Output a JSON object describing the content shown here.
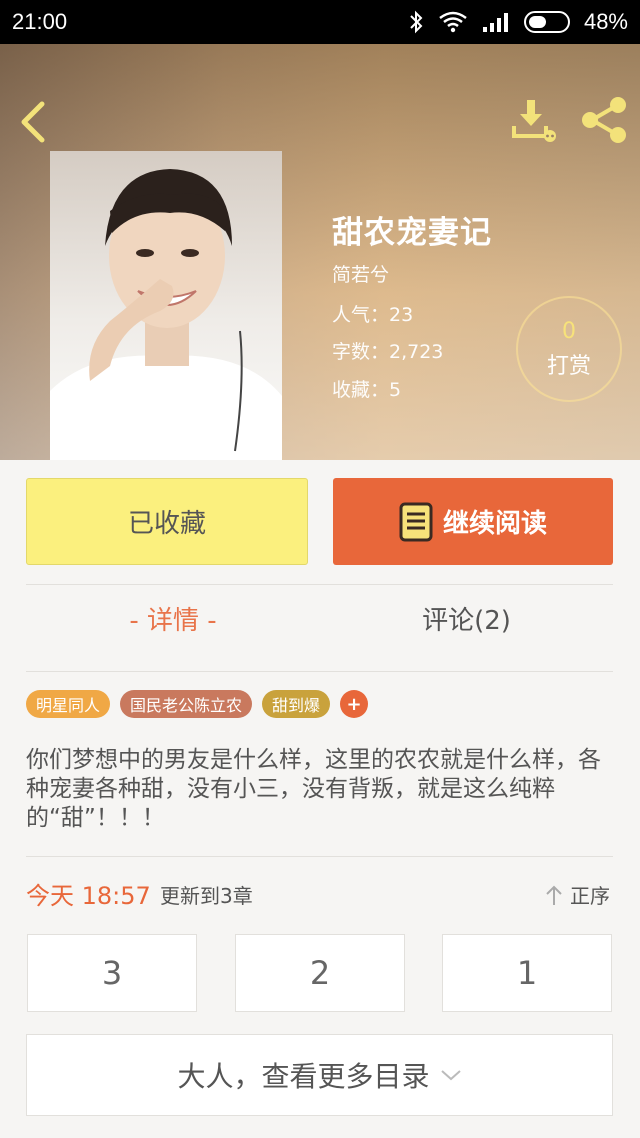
{
  "status_bar": {
    "time": "21:00",
    "battery": "48%",
    "battery_level": 0.48
  },
  "book": {
    "title": "甜农宠妻记",
    "author": "简若兮",
    "popularity": "人气：23",
    "word_count": "字数：2,723",
    "favorites": "收藏：5",
    "reward_count": "0",
    "reward_label": "打赏"
  },
  "actions": {
    "collected_label": "已收藏",
    "continue_label": "继续阅读"
  },
  "tabs": {
    "detail_label": "- 详情 -",
    "comments_label": "评论(2)"
  },
  "tags": [
    {
      "label": "明星同人",
      "color": "#f0a845"
    },
    {
      "label": "国民老公陈立农",
      "color": "#c9795e"
    },
    {
      "label": "甜到爆",
      "color": "#c9a23c"
    }
  ],
  "tag_add_label": "+",
  "description": "你们梦想中的男友是什么样，这里的农农就是什么样，各种宠妻各种甜，没有小三，没有背叛，就是这么纯粹的“甜”！！！",
  "update": {
    "time": "今天 18:57",
    "text": "更新到3章",
    "sort_label": "正序"
  },
  "chapters": [
    "3",
    "2",
    "1"
  ],
  "more_toc_label": "大人，查看更多目录",
  "colors": {
    "accent": "#e8673a",
    "collected_bg": "#fbf07e",
    "icon_yellow": "#f3e27a"
  }
}
